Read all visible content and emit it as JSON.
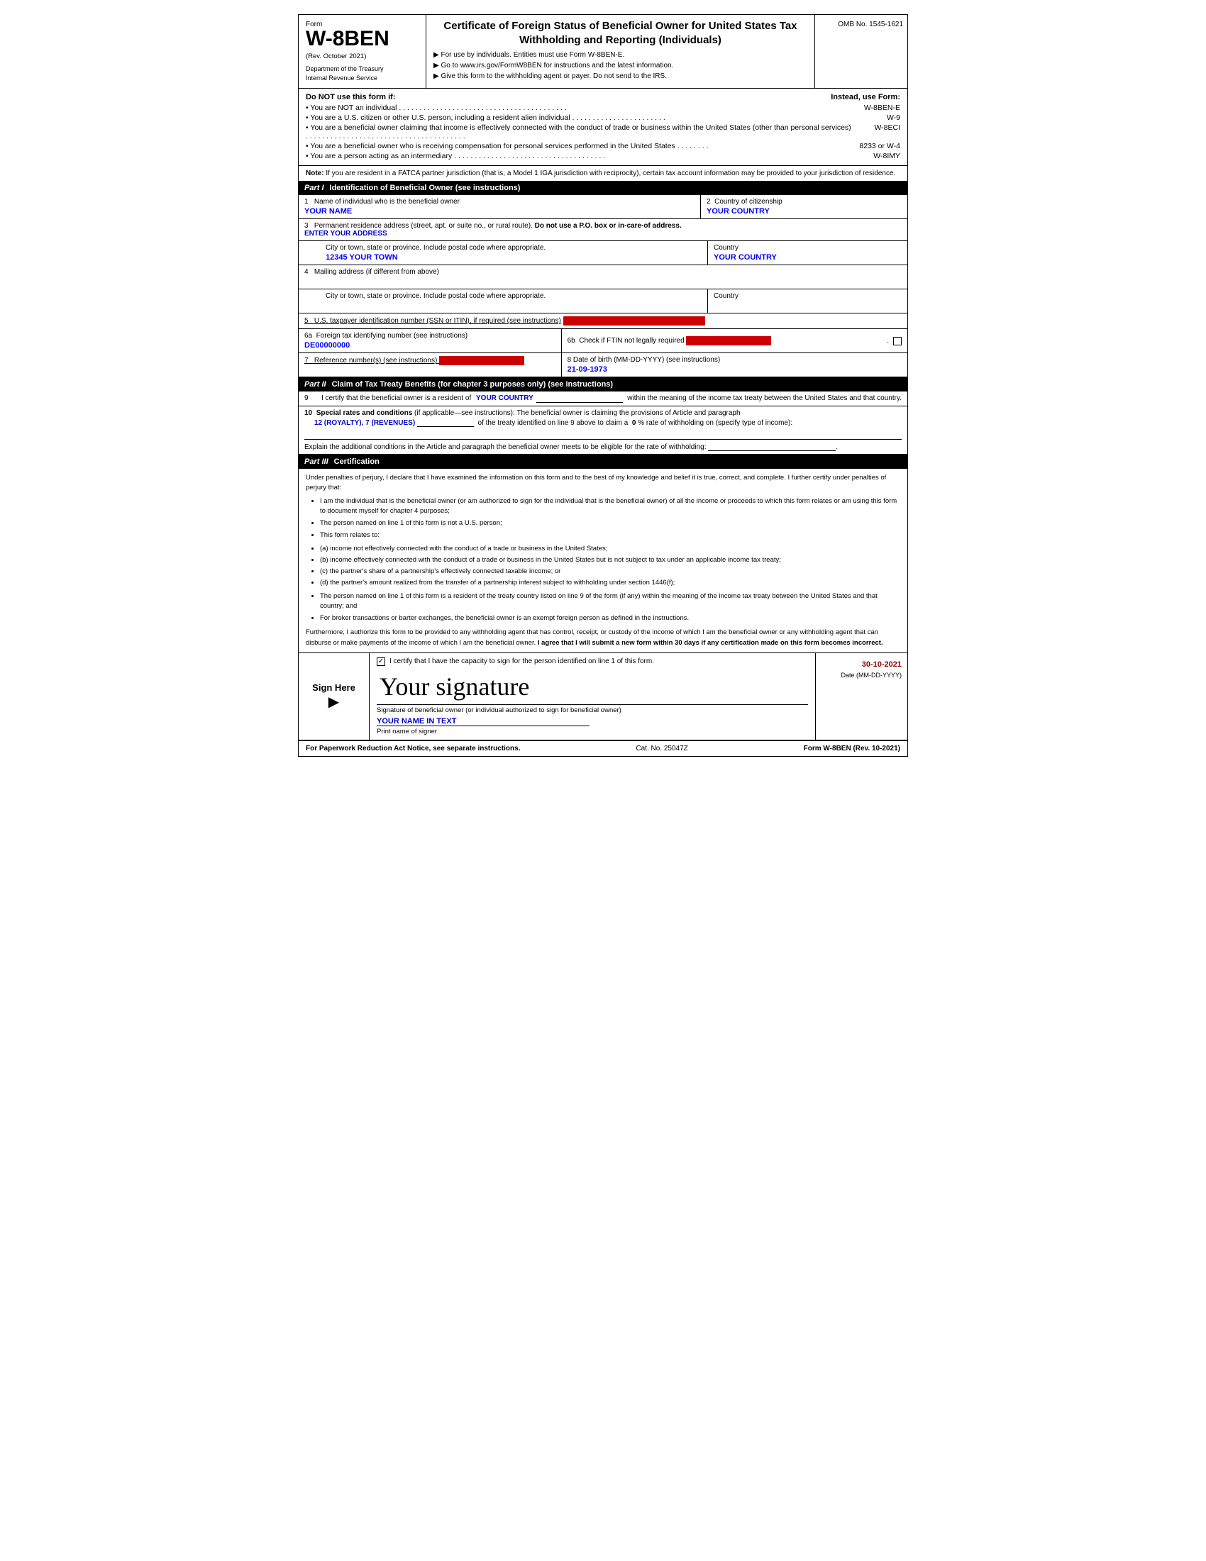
{
  "form": {
    "name": "W-8BEN",
    "rev_date": "(Rev. October  2021)",
    "dept_line1": "Department of the Treasury",
    "dept_line2": "Internal Revenue Service",
    "title": "Certificate of Foreign Status of Beneficial Owner for United States Tax Withholding and Reporting (Individuals)",
    "instruction1": "▶ For use by individuals. Entities must use Form W-8BEN-E.",
    "instruction2": "▶ Go to www.irs.gov/FormW8BEN for instructions and the latest information.",
    "instruction3": "▶ Give this form to the withholding agent or payer. Do not send to the IRS.",
    "omb": "OMB No. 1545-1621",
    "do_not_use_header": "Do NOT use this form if:",
    "instead_header": "Instead, use Form:",
    "do_not_use_items": [
      {
        "text": "You are NOT an individual . . . . . . . . . . . . . . . . . . . . . . . . . . . . . . . . . . . . . . . . .",
        "form_ref": "W-8BEN-E"
      },
      {
        "text": "You are a U.S. citizen or other U.S. person, including a resident alien individual . . . . . . . . . . . . . . . . . . . . . . .",
        "form_ref": "W-9"
      },
      {
        "text": "You are a beneficial owner claiming that income is effectively connected with the conduct of trade or business within the United States (other than personal services) . . . . . . . . . . . . . . . . . . . . . . . . . . . . . . . . . . . . . . .",
        "form_ref": "W-8ECI"
      },
      {
        "text": "You are a beneficial owner who is receiving compensation for personal services performed in the United States . . . . . . . .",
        "form_ref": "8233 or W-4"
      },
      {
        "text": "You are a person acting as an intermediary . . . . . . . . . . . . . . . . . . . . . . . . . . . . . . . . . . . . .",
        "form_ref": "W-8IMY"
      }
    ],
    "note": "Note: If you are resident in a FATCA partner jurisdiction (that is, a Model 1 IGA jurisdiction with reciprocity), certain tax account information may be provided to your jurisdiction of residence.",
    "part1": {
      "label": "Part I",
      "title": "Identification of Beneficial Owner (see instructions)",
      "field1_label": "1   Name of individual who is the beneficial owner",
      "field1_value": "YOUR NAME",
      "field2_label": "2   Country of citizenship",
      "field2_value": "YOUR COUNTRY",
      "field3_label": "3   Permanent residence address (street, apt. or suite no., or rural route). Do not use a P.O. box or in-care-of address.",
      "field3_bold": "Do not use a P.O. box or in-care-of address.",
      "field3_value": "ENTER YOUR ADDRESS",
      "field3_city_label": "City or town, state or province. Include postal code where appropriate.",
      "field3_city_value": "12345 YOUR TOWN",
      "field3_country_label": "Country",
      "field3_country_value": "YOUR COUNTRY",
      "field4_label": "4   Mailing address (if different from above)",
      "field4_city_label": "City or town, state or province. Include postal code where appropriate.",
      "field4_country_label": "Country",
      "field5_label": "5   U.S. taxpayer identification number (SSN or ITIN), if required (see instructions)",
      "field5_value": "REDACTED",
      "field6a_label": "6a  Foreign tax identifying number (see instructions)",
      "field6a_value": "DE00000000",
      "field6b_label": "6b  Check if FTIN not legally required",
      "field6b_value": "REDACTED",
      "field7_label": "7   Reference number(s) (see instructions)",
      "field7_value": "REDACTED",
      "field8_label": "8   Date of birth (MM-DD-YYYY) (see instructions)",
      "field8_value": "21-09-1973"
    },
    "part2": {
      "label": "Part II",
      "title": "Claim of Tax Treaty Benefits (for chapter 3 purposes only) (see instructions)",
      "field9_num": "9",
      "field9_text": "I certify that the beneficial owner is a resident of",
      "field9_value": "YOUR COUNTRY",
      "field9_text2": "within the meaning of the income tax treaty between the United States and that country.",
      "field10_num": "10",
      "field10_text": "Special rates and conditions (if applicable—see instructions): The beneficial owner is claiming the provisions of Article and paragraph",
      "field10_value": "12 (ROYALTY), 7 (REVENUES)",
      "field10_text2": "of the treaty identified on line 9 above to claim a",
      "field10_rate": "0",
      "field10_text3": "% rate of withholding on (specify type of income):",
      "field10_explain": "Explain the additional conditions in the Article and paragraph the beneficial owner meets to be eligible for the rate of withholding:"
    },
    "part3": {
      "label": "Part III",
      "title": "Certification",
      "under_penalties": "Under penalties of perjury, I declare that I have examined the information on this form and to the best of my knowledge and belief it is true, correct, and complete. I further certify under penalties of perjury that:",
      "bullets": [
        "I am the individual that is the beneficial owner (or am authorized to sign for the individual that is the beneficial owner) of all the income or proceeds to which this form relates or am using this form to document myself for chapter 4 purposes;",
        "The person named on line 1 of this form is not a U.S. person;",
        "This form relates to:"
      ],
      "sub_bullets": [
        "(a) income not effectively connected with the conduct of a trade or business in the United States;",
        "(b) income effectively connected with the conduct of a trade or business in the United States but is not subject to tax under an applicable income tax treaty;",
        "(c) the partner's share of a partnership's effectively connected taxable income; or",
        "(d) the partner's amount realized from the transfer of a partnership interest subject to withholding under section 1446(f);"
      ],
      "bullet2": "The person named on line 1 of this form is a resident of the treaty country listed on line 9 of the form (if any) within the meaning of the income tax treaty between the United States and that country; and",
      "bullet3": "For broker transactions or barter exchanges, the beneficial owner is an exempt foreign person as defined in the instructions.",
      "furthermore": "Furthermore, I authorize this form to be provided to any withholding agent that has control, receipt, or custody of the income of which I am the beneficial owner or any withholding agent that can disburse or make payments of the income of which I am the beneficial owner.",
      "agree_bold": "I agree that I will submit a new form within 30 days if any certification made on this form becomes incorrect."
    },
    "sign": {
      "sign_here": "Sign Here",
      "checkbox_label": "I certify that I have the capacity to sign for the person identified on line 1 of this form.",
      "signature_text": "Your signature",
      "sig_label": "Signature of beneficial owner (or individual authorized to sign for beneficial owner)",
      "date_value": "30-10-2021",
      "date_label": "Date (MM-DD-YYYY)",
      "print_name_value": "YOUR NAME IN TEXT",
      "print_name_label": "Print name of signer"
    },
    "footer": {
      "left": "For Paperwork Reduction Act Notice, see separate instructions.",
      "cat": "Cat. No. 25047Z",
      "form_ref": "Form W-8BEN (Rev. 10-2021)"
    }
  }
}
